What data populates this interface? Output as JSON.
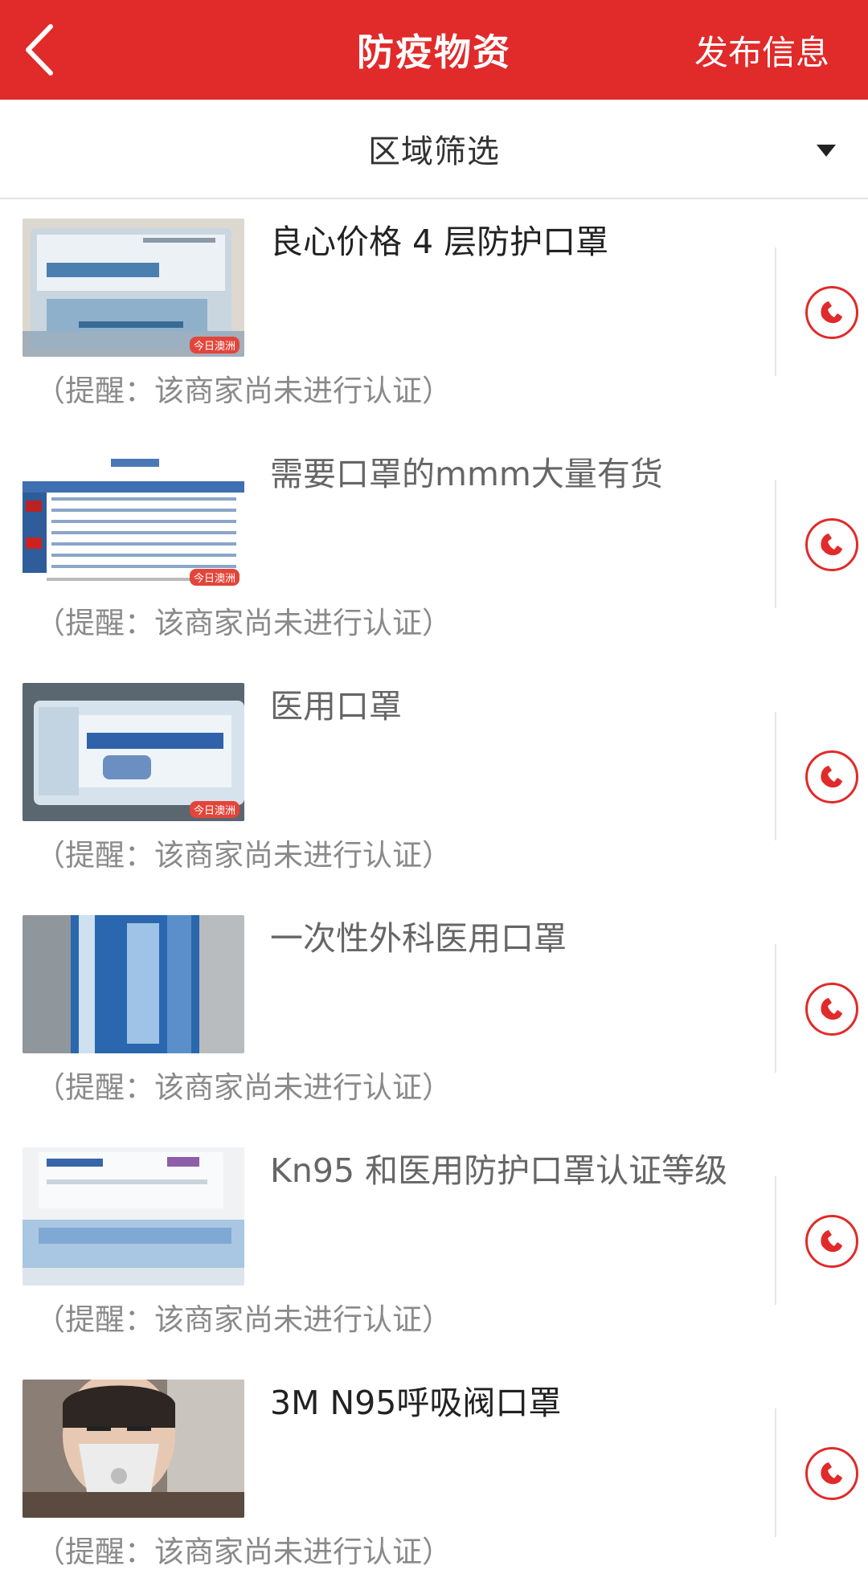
{
  "header": {
    "back_icon": "chevron-left-icon",
    "title": "防疫物资",
    "publish_label": "发布信息",
    "color": "#e12a2a"
  },
  "filter": {
    "label": "区域筛选",
    "caret_icon": "caret-down-icon"
  },
  "items": [
    {
      "title": "良心价格 4 层防护口罩",
      "note": "（提醒：该商家尚未进行认证）",
      "icon": "phone-icon",
      "image": "mask-box-photo",
      "watermark": "今日澳洲"
    },
    {
      "title": "需要口罩的mmm大量有货",
      "note": "（提醒：该商家尚未进行认证）",
      "icon": "phone-icon",
      "image": "standards-table-photo",
      "watermark": "今日澳洲"
    },
    {
      "title": "医用口罩",
      "note": "（提醒：该商家尚未进行认证）",
      "icon": "phone-icon",
      "image": "mask-pack-photo",
      "watermark": "今日澳洲"
    },
    {
      "title": "一次性外科医用口罩",
      "note": "（提醒：该商家尚未进行认证）",
      "icon": "phone-icon",
      "image": "mask-pack-blue-photo"
    },
    {
      "title": "Kn95 和医用防护口罩认证等级",
      "note": "（提醒：该商家尚未进行认证）",
      "icon": "phone-icon",
      "image": "mask-boxes-photo"
    },
    {
      "title": "3M N95呼吸阀口罩",
      "note": "（提醒：该商家尚未进行认证）",
      "icon": "phone-icon",
      "image": "person-wearing-n95-photo"
    }
  ]
}
